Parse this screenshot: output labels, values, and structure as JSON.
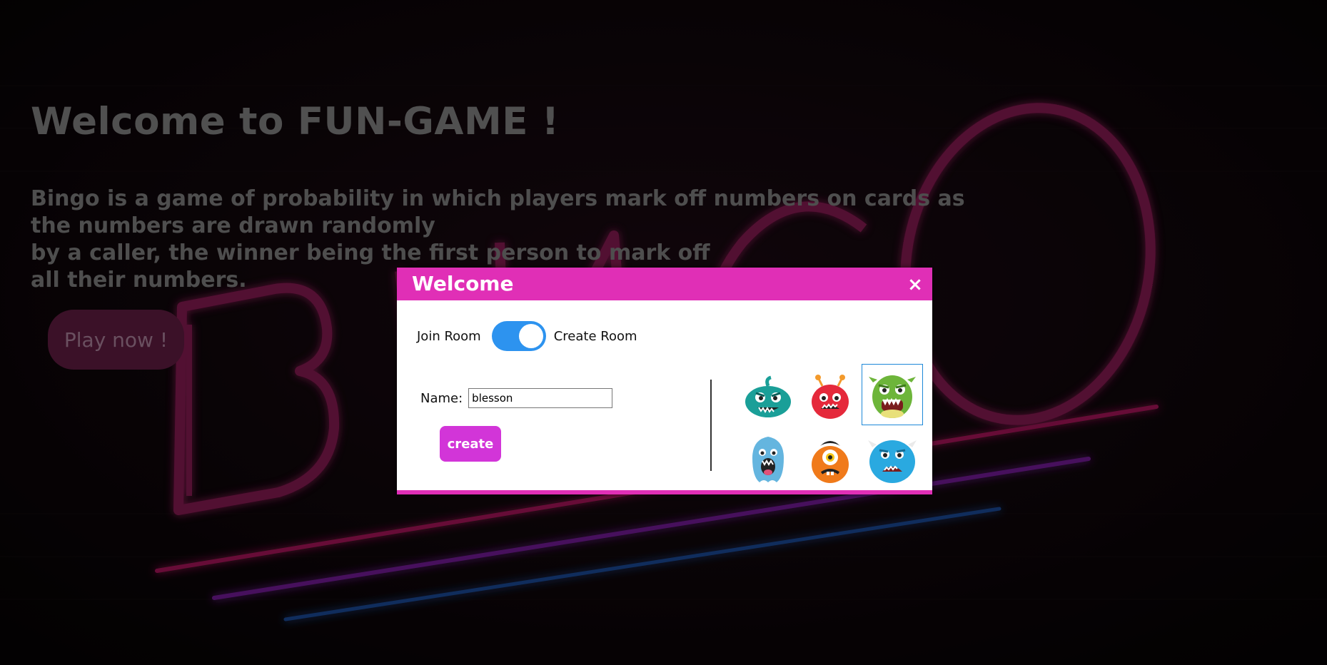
{
  "hero": {
    "title": "Welcome to FUN-GAME !",
    "lines": [
      "Bingo is a game of probability in which players mark off numbers on cards as",
      "the numbers are drawn randomly",
      "by a caller, the winner being the first person to mark off",
      "all their numbers."
    ],
    "play_label": "Play now !"
  },
  "background": {
    "sign_text": "BINGO"
  },
  "modal": {
    "title": "Welcome",
    "close_symbol": "×",
    "toggle": {
      "left_label": "Join Room",
      "right_label": "Create Room",
      "state": "Create Room"
    },
    "name_label": "Name:",
    "name_value": "blesson",
    "create_label": "create",
    "avatars": [
      {
        "name": "teal-monster-avatar",
        "color": "#1a9f98",
        "selected": false
      },
      {
        "name": "red-antenna-monster-avatar",
        "color": "#e5293b",
        "selected": false
      },
      {
        "name": "green-monster-avatar",
        "color": "#6db53a",
        "selected": true
      },
      {
        "name": "blue-tall-monster-avatar",
        "color": "#64b5df",
        "selected": false
      },
      {
        "name": "orange-cyclops-monster-avatar",
        "color": "#f07a1a",
        "selected": false
      },
      {
        "name": "blue-furry-monster-avatar",
        "color": "#2aa9e0",
        "selected": false
      }
    ]
  },
  "colors": {
    "accent_pink": "#e02fb6",
    "create_purple": "#d235d8",
    "toggle_blue": "#2d93ef",
    "selected_border": "#1d88d8"
  }
}
